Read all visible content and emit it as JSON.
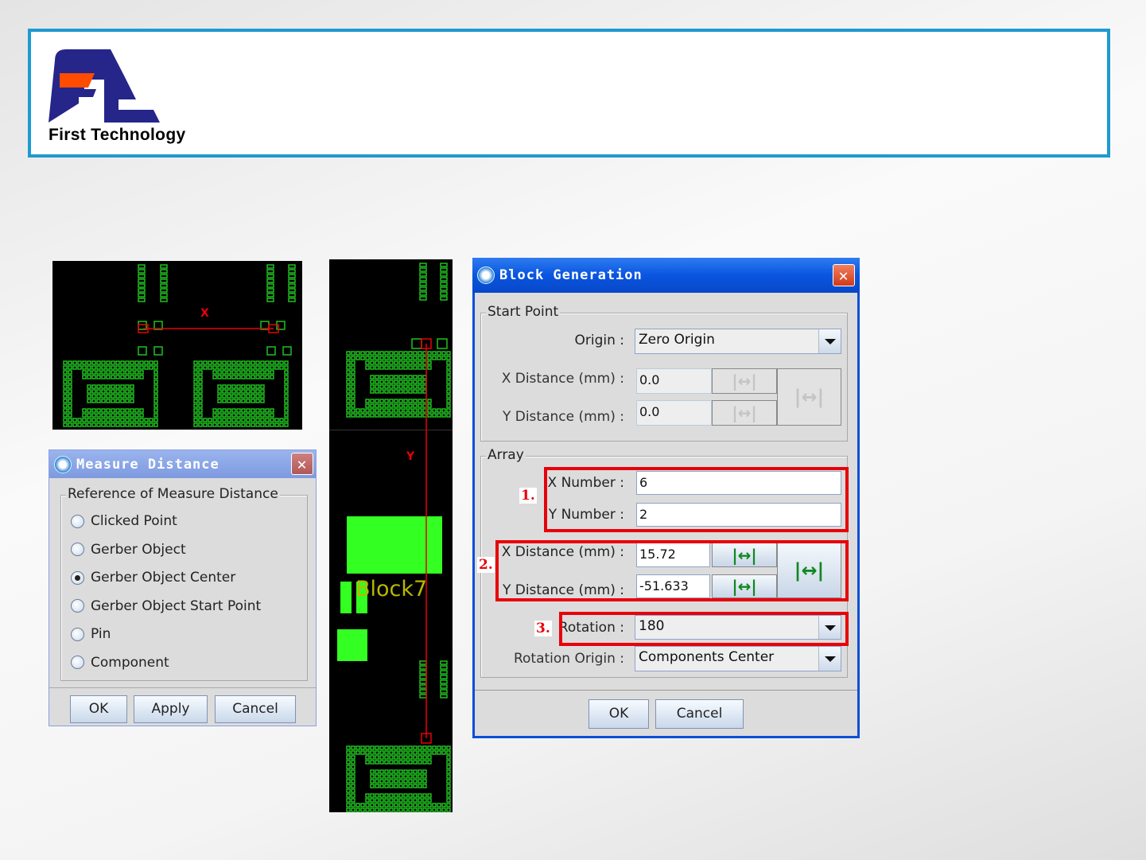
{
  "header": {
    "company": "First Technology",
    "logo_letters": "Ft",
    "colors": {
      "border": "#1e9ad0",
      "logo_blue": "#25258a",
      "logo_orange": "#ff4c00"
    }
  },
  "pcb_top": {
    "measure_label": "X"
  },
  "pcb_tall": {
    "measure_label": "Y",
    "block_label": "Block7"
  },
  "measure_dialog": {
    "title": "Measure Distance",
    "group": "Reference of Measure Distance",
    "options": [
      {
        "label": "Clicked Point",
        "selected": false
      },
      {
        "label": "Gerber Object",
        "selected": false
      },
      {
        "label": "Gerber Object Center",
        "selected": true
      },
      {
        "label": "Gerber Object Start Point",
        "selected": false
      },
      {
        "label": "Pin",
        "selected": false
      },
      {
        "label": "Component",
        "selected": false
      }
    ],
    "ok": "OK",
    "apply": "Apply",
    "cancel": "Cancel"
  },
  "block_dialog": {
    "title": "Block Generation",
    "start_point": {
      "group": "Start Point",
      "origin_label": "Origin :",
      "origin_value": "Zero Origin",
      "x_label": "X Distance (mm) :",
      "x_value": "0.0",
      "y_label": "Y Distance (mm) :",
      "y_value": "0.0"
    },
    "array": {
      "group": "Array",
      "x_number_label": "X Number :",
      "x_number": "6",
      "y_number_label": "Y Number :",
      "y_number": "2",
      "x_dist_label": "X Distance (mm) :",
      "x_dist": "15.72",
      "y_dist_label": "Y Distance (mm) :",
      "y_dist": "-51.633",
      "rotation_label": "Rotation :",
      "rotation": "180",
      "rotation_origin_label": "Rotation Origin :",
      "rotation_origin": "Components Center"
    },
    "callouts": [
      "1.",
      "2.",
      "3."
    ],
    "measure_glyph": "|↔|",
    "ok": "OK",
    "cancel": "Cancel"
  }
}
